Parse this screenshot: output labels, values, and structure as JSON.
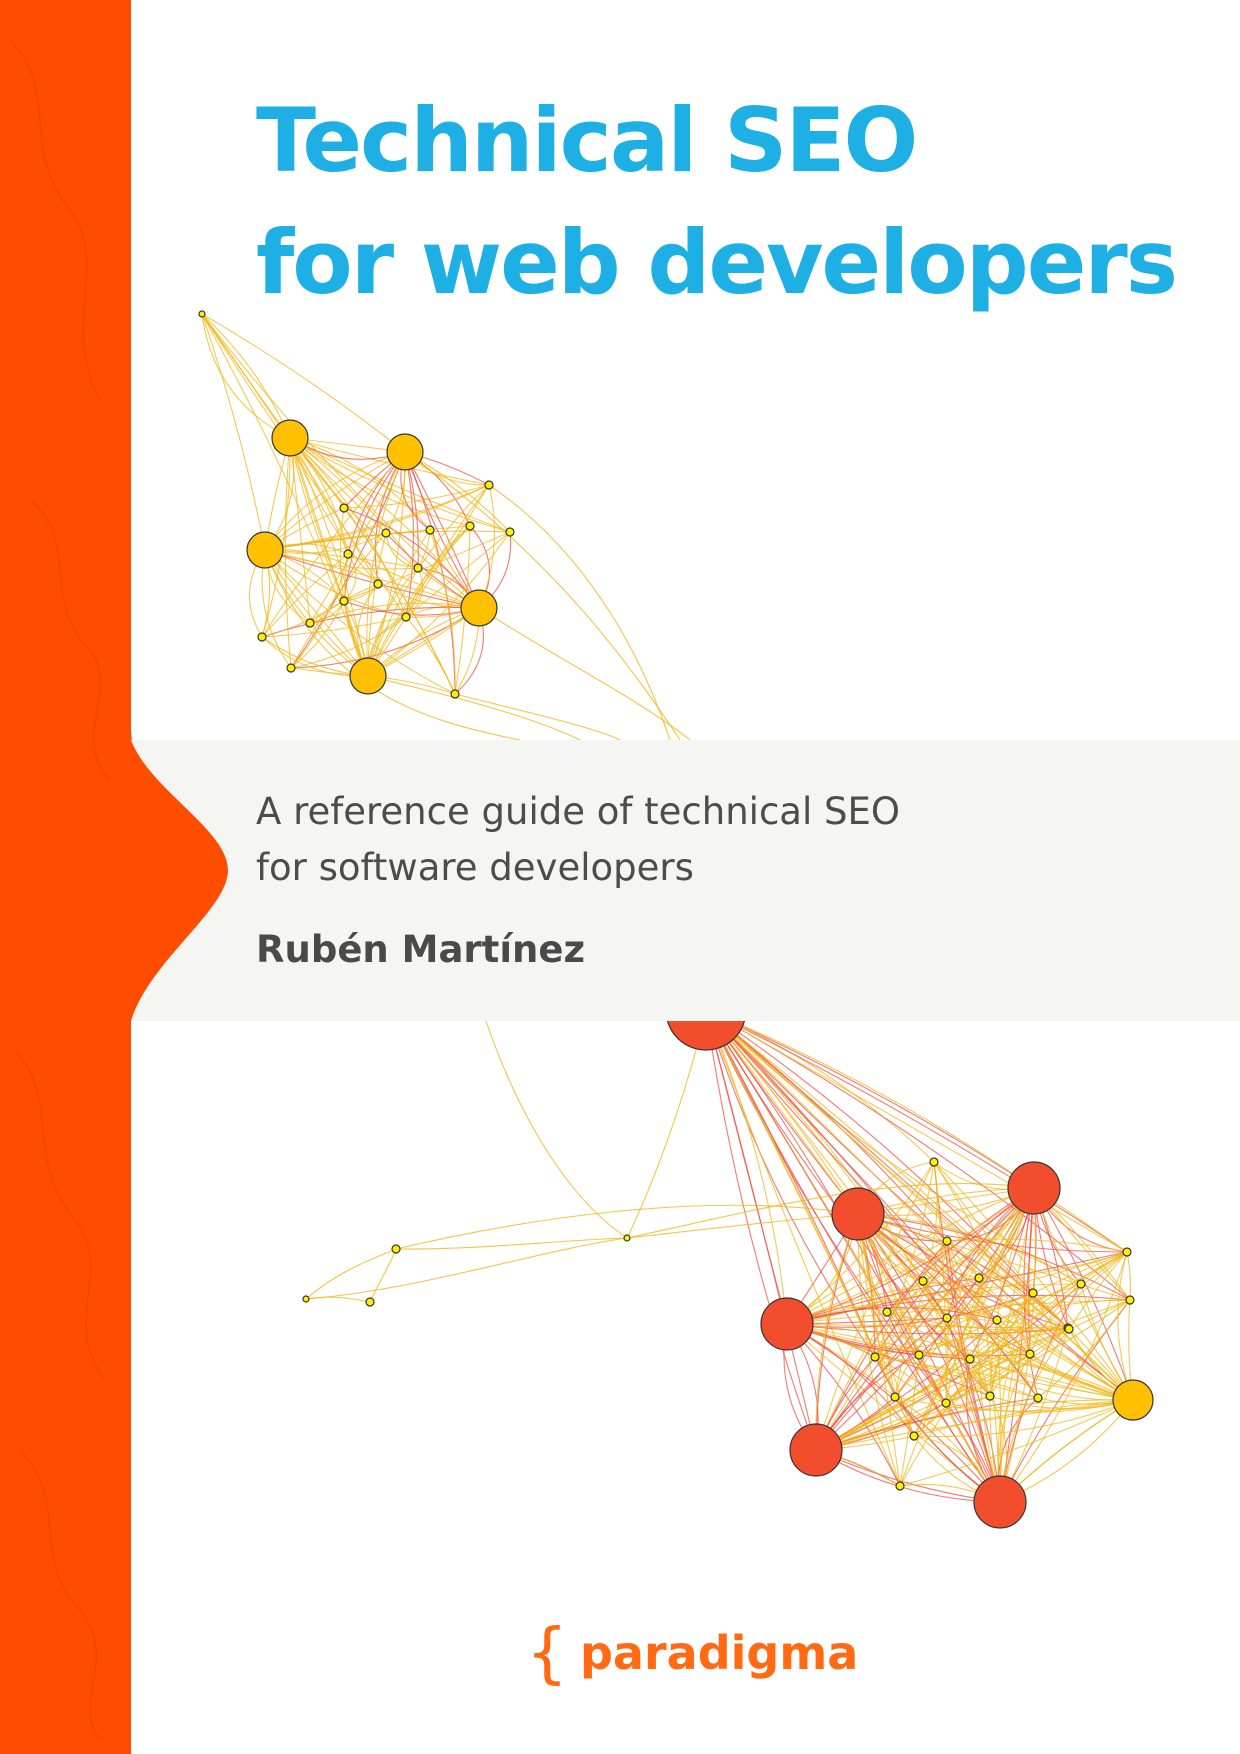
{
  "cover": {
    "title_lines": [
      "Technical SEO",
      "for web developers"
    ],
    "subtitle_lines": [
      "A reference guide of technical SEO",
      "for software developers"
    ],
    "author": "Rubén Martínez",
    "publisher": {
      "brace": "{",
      "name": "paradigma"
    }
  },
  "colors": {
    "accent_orange": "#ff4d00",
    "title_blue": "#1eb0e4",
    "band_gray": "#f5f5f3",
    "node_yellow": "#ffc000",
    "node_red": "#f24e2e",
    "edge_yellow": "#f0b71a",
    "edge_red": "#ee4d45"
  },
  "illustration": {
    "kind": "network graph",
    "node_icon": "graph-node-icon"
  }
}
